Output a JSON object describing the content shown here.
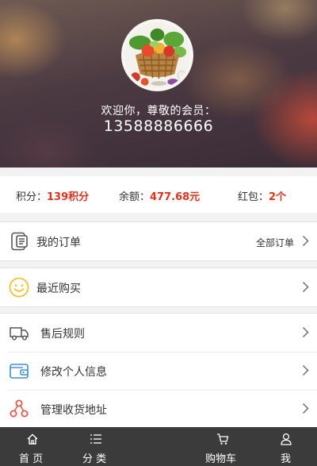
{
  "header": {
    "welcome_text": "欢迎你，尊敬的会员：",
    "phone": "13588886666",
    "avatar_icon": "vegetable-basket-avatar"
  },
  "stats": {
    "points_label": "积分：",
    "points_value": "139积分",
    "balance_label": "余额：",
    "balance_value": "477.68元",
    "redpacket_label": "红包：",
    "redpacket_value": "2个",
    "value_color": "#e2331d"
  },
  "menu": {
    "orders": {
      "label": "我的订单",
      "right_label": "全部订单",
      "icon": "order-list-icon"
    },
    "recent": {
      "label": "最近购买",
      "icon": "smiley-icon"
    },
    "after_sale": {
      "label": "售后规则",
      "icon": "truck-icon"
    },
    "profile": {
      "label": "修改个人信息",
      "icon": "wallet-card-icon"
    },
    "address": {
      "label": "管理收货地址",
      "icon": "share-nodes-icon"
    }
  },
  "tabbar": {
    "home": "首 页",
    "category": "分 类",
    "cart": "购物车",
    "me": "我"
  },
  "colors": {
    "accent_red": "#e2331d",
    "tabbar_bg": "#3b3b3b",
    "smiley_yellow": "#f2c230",
    "wallet_blue": "#3f8fd8",
    "share_red": "#e15a4c"
  }
}
